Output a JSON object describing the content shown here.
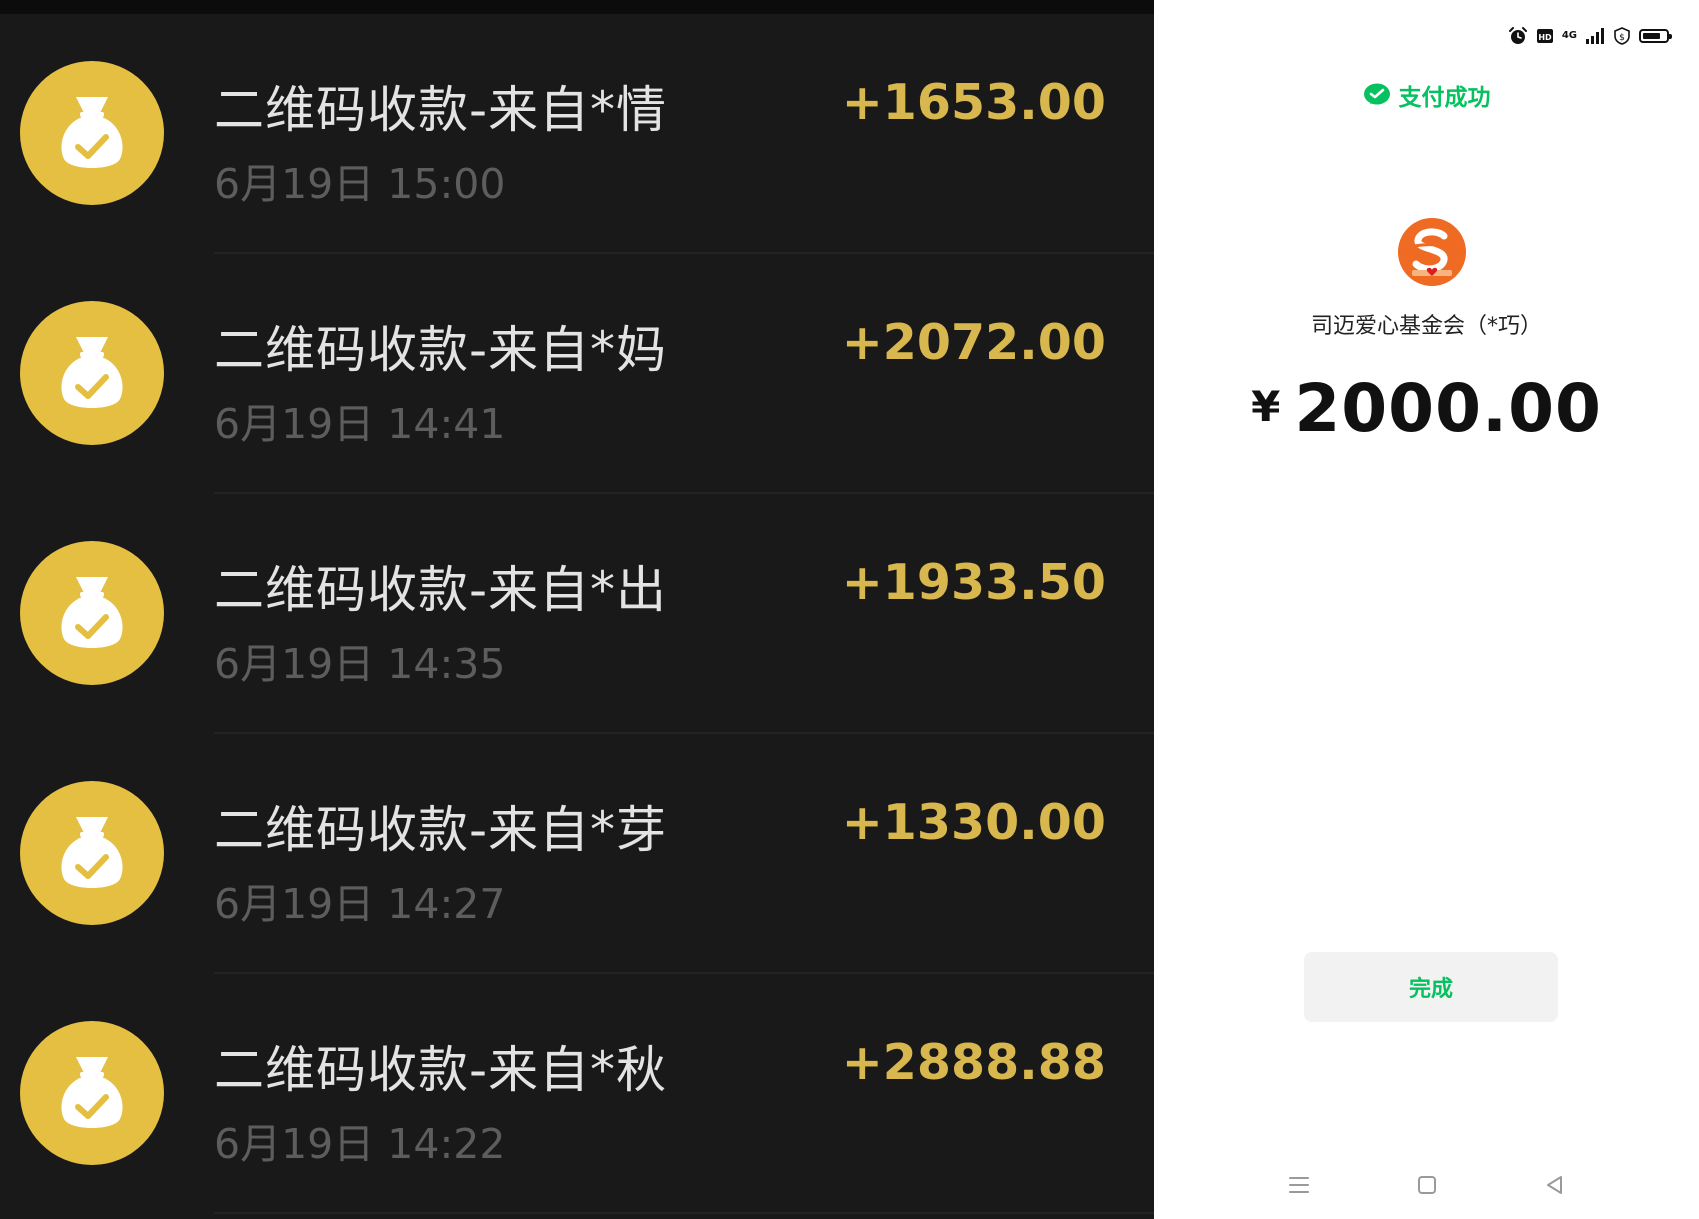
{
  "transactions": [
    {
      "title": "二维码收款-来自*情",
      "time": "6月19日 15:00",
      "amount": "+1653.00"
    },
    {
      "title": "二维码收款-来自*妈",
      "time": "6月19日 14:41",
      "amount": "+2072.00"
    },
    {
      "title": "二维码收款-来自*出",
      "time": "6月19日 14:35",
      "amount": "+1933.50"
    },
    {
      "title": "二维码收款-来自*芽",
      "time": "6月19日 14:27",
      "amount": "+1330.00"
    },
    {
      "title": "二维码收款-来自*秋",
      "time": "6月19日 14:22",
      "amount": "+2888.88"
    }
  ],
  "icons": {
    "transaction": "money-bag-check-icon",
    "status_bar": [
      "alarm-icon",
      "hd-icon",
      "signal-icon",
      "shield-icon",
      "battery-icon"
    ],
    "nav": [
      "menu-icon",
      "home-square-icon",
      "back-triangle-icon"
    ]
  },
  "status_bar": {
    "network": "4G",
    "battery_level": 0.75
  },
  "payment": {
    "status": "支付成功",
    "merchant": "司迈爱心基金会（*巧）",
    "currency": "¥",
    "amount": "2000.00",
    "done_label": "完成"
  },
  "colors": {
    "dark_bg": "#191919",
    "gold_icon": "#e4bf41",
    "gold_amount": "#d8b74e",
    "wechat_green": "#07c160",
    "merchant_orange": "#ef6a23"
  }
}
